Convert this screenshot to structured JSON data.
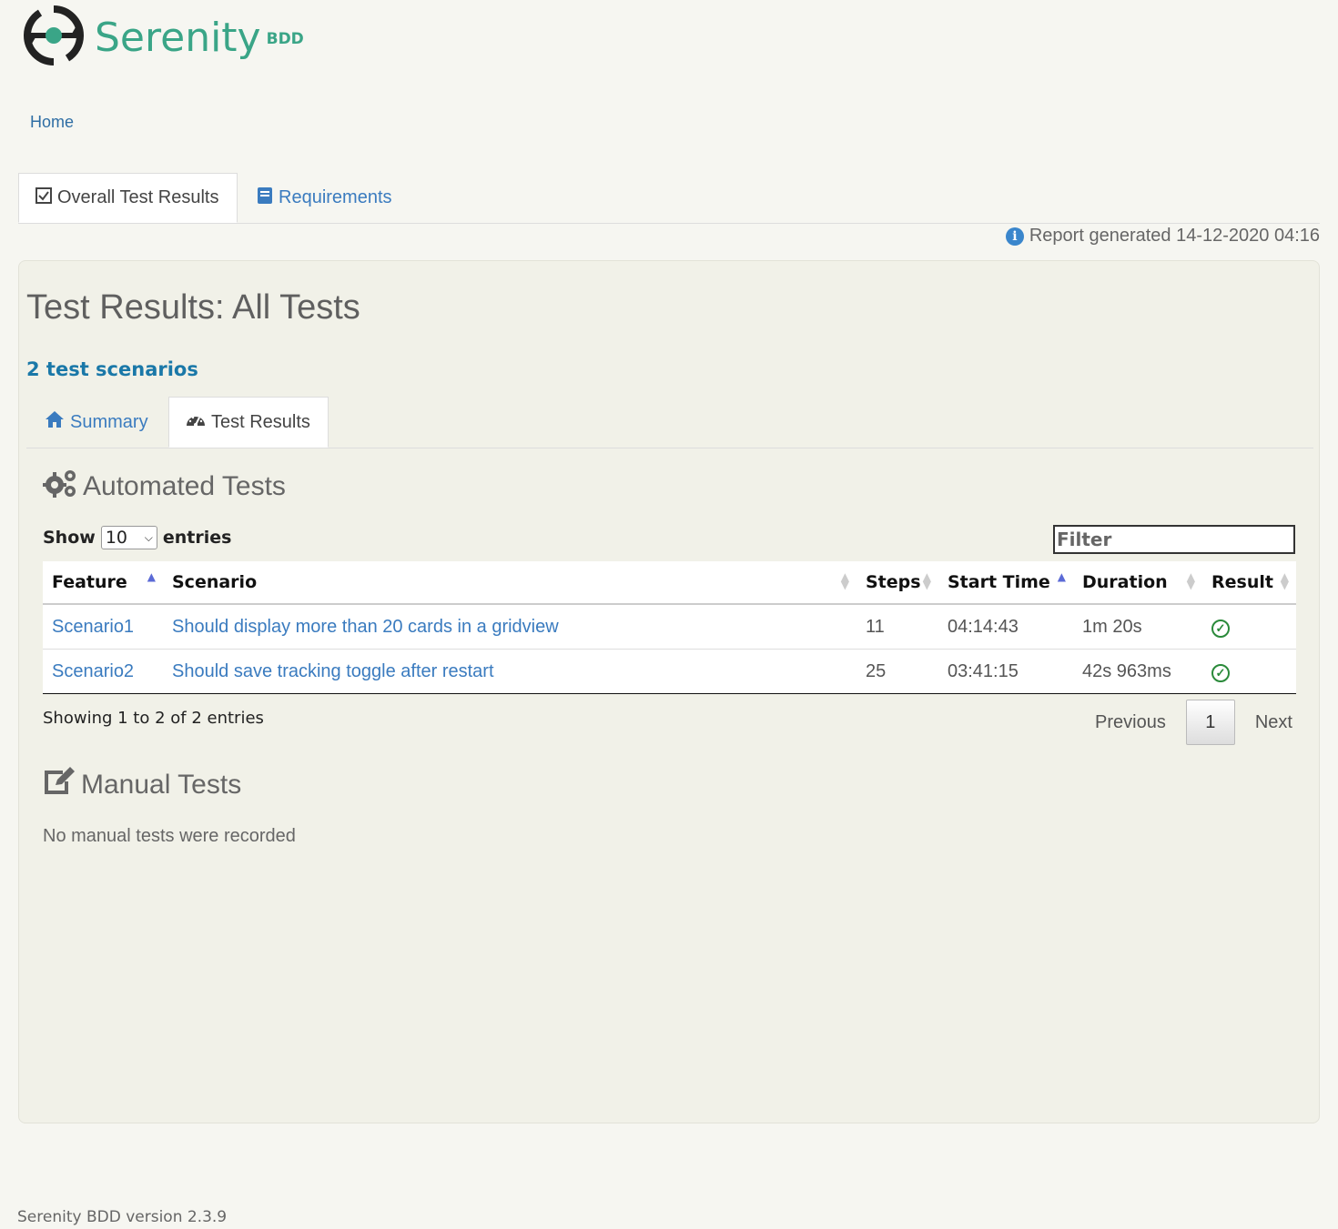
{
  "logo": {
    "text": "Serenity",
    "sub": "BDD"
  },
  "breadcrumb": {
    "home": "Home"
  },
  "top_tabs": [
    {
      "label": "Overall Test Results",
      "icon": "checkbox-icon"
    },
    {
      "label": "Requirements",
      "icon": "book-icon"
    }
  ],
  "report_generated": "Report generated 14-12-2020 04:16",
  "page": {
    "title": "Test Results: All Tests",
    "count": "2 test scenarios"
  },
  "inner_tabs": [
    {
      "label": "Summary",
      "icon": "home-icon"
    },
    {
      "label": "Test Results",
      "icon": "dashboard-icon"
    }
  ],
  "automated": {
    "title": "Automated Tests",
    "show_label": "Show",
    "entries_value": "10",
    "entries_label": "entries",
    "filter_placeholder": "Filter",
    "columns": [
      "Feature",
      "Scenario",
      "Steps",
      "Start Time",
      "Duration",
      "Result"
    ],
    "rows": [
      {
        "feature": "Scenario1",
        "scenario": "Should display more than 20 cards in a gridview",
        "steps": "11",
        "start": "04:14:43",
        "duration": "1m 20s",
        "result": "success"
      },
      {
        "feature": "Scenario2",
        "scenario": "Should save tracking toggle after restart",
        "steps": "25",
        "start": "03:41:15",
        "duration": "42s 963ms",
        "result": "success"
      }
    ],
    "showing": "Showing 1 to 2 of 2 entries",
    "pager": {
      "previous": "Previous",
      "current": "1",
      "next": "Next"
    }
  },
  "manual": {
    "title": "Manual Tests",
    "empty": "No manual tests were recorded"
  },
  "footer": "Serenity BDD version 2.3.9",
  "colors": {
    "brand": "#3aa587",
    "link": "#3a7bbf",
    "success": "#2a8a3a"
  }
}
